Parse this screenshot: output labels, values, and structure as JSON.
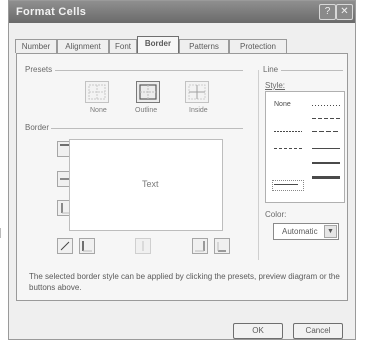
{
  "window": {
    "title": "Format Cells",
    "help_glyph": "?",
    "close_glyph": "✕"
  },
  "tabs": [
    {
      "label": "Number"
    },
    {
      "label": "Alignment"
    },
    {
      "label": "Font"
    },
    {
      "label": "Border"
    },
    {
      "label": "Patterns"
    },
    {
      "label": "Protection"
    }
  ],
  "presets": {
    "group_label": "Presets",
    "items": [
      {
        "label": "None"
      },
      {
        "label": "Outline"
      },
      {
        "label": "Inside"
      }
    ]
  },
  "border": {
    "group_label": "Border",
    "preview_text": "Text"
  },
  "line": {
    "group_label": "Line",
    "style_label": "Style:",
    "style_none": "None",
    "color_label": "Color:",
    "color_value": "Automatic"
  },
  "help_text": "The selected border style can be applied by clicking the presets, preview diagram or the buttons above.",
  "buttons": {
    "ok": "OK",
    "cancel": "Cancel"
  },
  "colors": {
    "titlebar": "#7a7a7a",
    "panel": "#f6f6f6"
  }
}
